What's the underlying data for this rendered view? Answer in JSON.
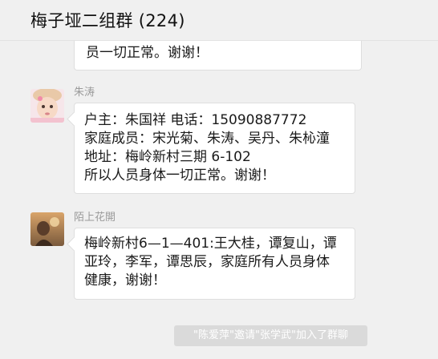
{
  "header": {
    "title": "梅子垭二组群 (224)"
  },
  "messages": [
    {
      "sender": "",
      "avatar": "",
      "lines": [
        "员一切正常。谢谢！"
      ]
    },
    {
      "sender": "朱涛",
      "avatar": "baby-photo-avatar",
      "lines": [
        "户主：朱国祥   电话：15090887772",
        "家庭成员：宋光菊、朱涛、吴丹、朱杺潼",
        "地址：梅岭新村三期    6-102",
        "所以人员身体一切正常。谢谢！"
      ]
    },
    {
      "sender": "陌上花開",
      "avatar": "sunset-portrait-avatar",
      "lines": [
        "梅岭新村6—1—401:王大桂，谭复山，谭",
        "亚玲，李军，谭思辰，家庭所有人员身体",
        "健康，谢谢！"
      ]
    }
  ],
  "system_notice": "\"陈爱萍\"邀请\"张学武\"加入了群聊",
  "colors": {
    "background": "#f0f0f0",
    "bubble": "#ffffff",
    "system_notice_bg": "#dadada",
    "sender_name": "#9a9a9a"
  }
}
